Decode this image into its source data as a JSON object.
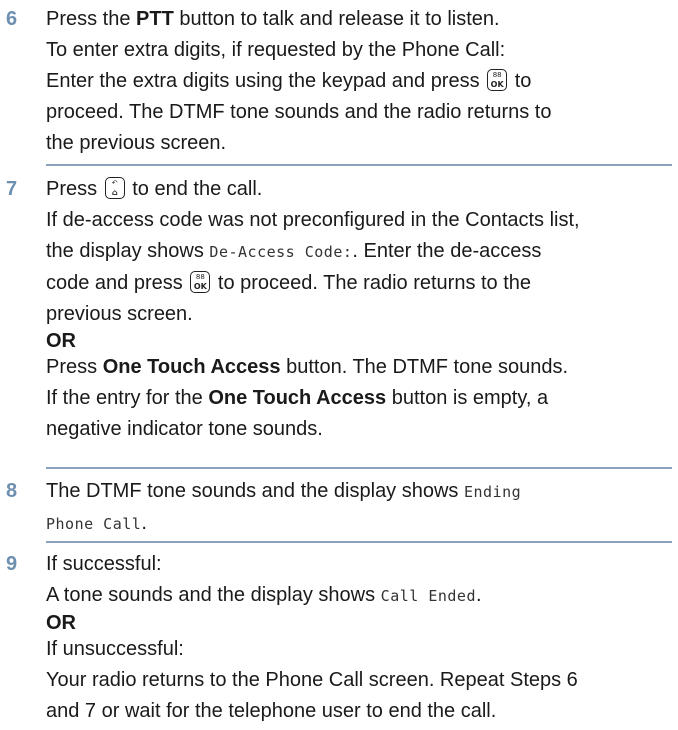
{
  "steps": [
    {
      "number": "6",
      "l1_pre": "Press the ",
      "l1_bold": "PTT",
      "l1_post": " button to talk and release it to listen.",
      "l2": "To enter extra digits, if requested by the Phone Call:",
      "l3_pre": "Enter the extra digits using the keypad and press ",
      "l3_post": " to",
      "l4": "proceed. The DTMF tone sounds and the radio returns to",
      "l5": "the previous screen."
    },
    {
      "number": "7",
      "l1_pre": "Press ",
      "l1_post": " to end the call.",
      "l2": "If de-access code was not preconfigured in the Contacts list,",
      "l3_pre": "the display shows ",
      "l3_mono": "De-Access Code:",
      "l3_post": ". Enter the de-access",
      "l4_pre": "code and press ",
      "l4_post": " to proceed. The radio returns to the",
      "l5": "previous screen.",
      "or": "OR",
      "l6_pre": "Press ",
      "l6_bold": "One Touch Access",
      "l6_post": " button. The DTMF tone sounds.",
      "l7_pre": "If the entry for the ",
      "l7_bold": "One Touch Access",
      "l7_post": " button is empty, a",
      "l8": "negative indicator tone sounds."
    },
    {
      "number": "8",
      "l1_pre": "The DTMF tone sounds and the display shows ",
      "l1_mono": "Ending",
      "l2_mono": "Phone Call",
      "l2_post": "."
    },
    {
      "number": "9",
      "l1": "If successful:",
      "l2_pre": "A tone sounds and the display shows ",
      "l2_mono": "Call Ended",
      "l2_post": ".",
      "or1": "OR",
      "l3": "If unsuccessful:",
      "l4": "Your radio returns to the Phone Call screen. Repeat Steps 6",
      "l5": "and 7 or wait for the telephone user to end the call."
    }
  ],
  "keys": {
    "menu_ok": {
      "top": "88",
      "bottom": "OK",
      "icon": "menu-ok-key-icon"
    },
    "back_home": {
      "top": "↶",
      "bottom": "⌂",
      "icon": "back-home-key-icon"
    }
  }
}
